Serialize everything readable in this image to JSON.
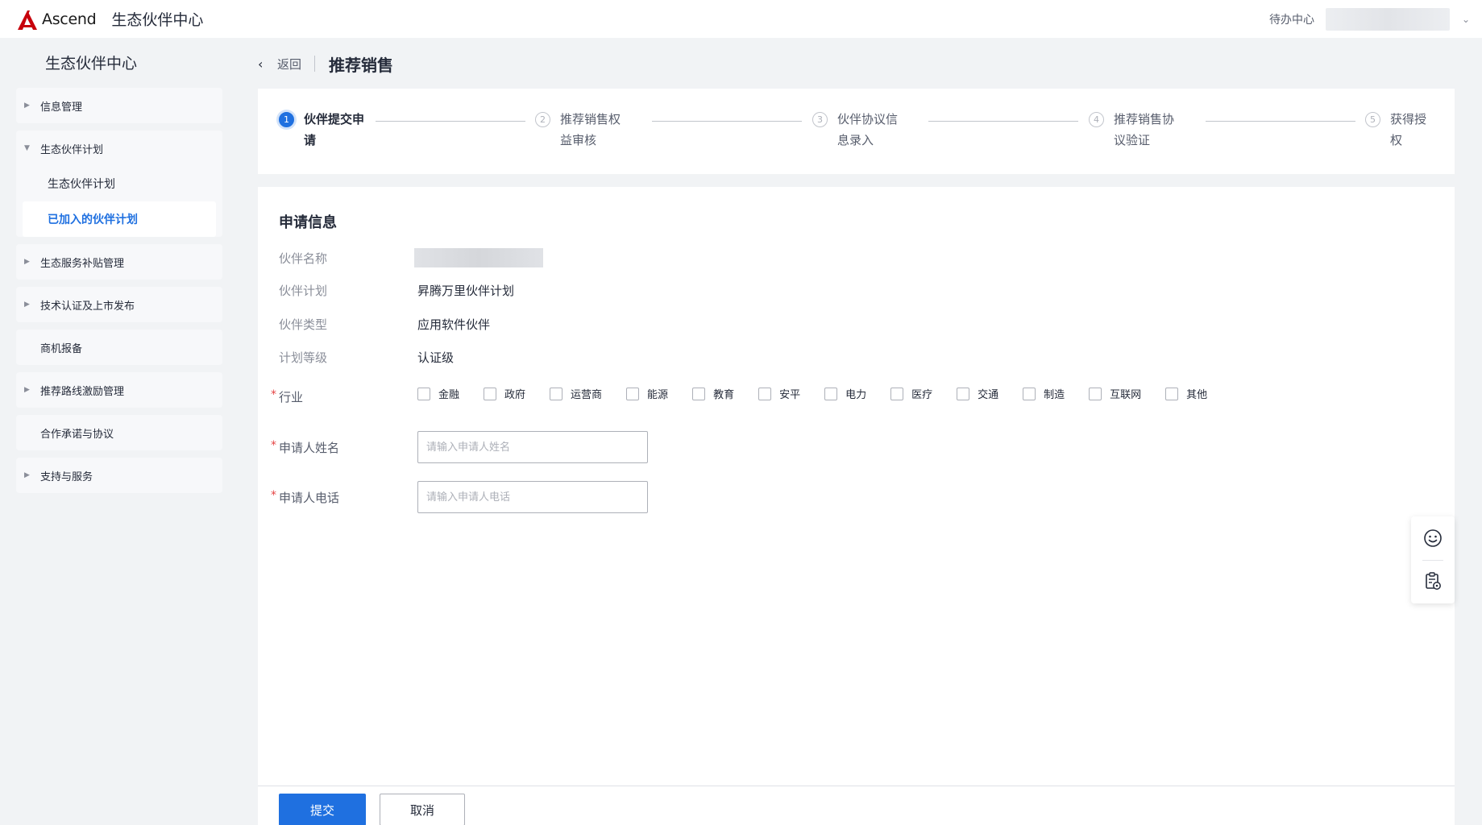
{
  "header": {
    "logo_text": "Ascend",
    "app_title": "生态伙伴中心",
    "todo_label": "待办中心",
    "user_chevron": "⌄",
    "brand_color": "#c7000b"
  },
  "sidebar": {
    "title": "生态伙伴中心",
    "items": [
      {
        "label": "信息管理",
        "arrow": "▶"
      },
      {
        "label": "生态伙伴计划",
        "arrow": "▼",
        "children": [
          {
            "label": "生态伙伴计划"
          },
          {
            "label": "已加入的伙伴计划"
          }
        ]
      },
      {
        "label": "生态服务补贴管理",
        "arrow": "▶"
      },
      {
        "label": "技术认证及上市发布",
        "arrow": "▶"
      },
      {
        "label": "商机报备"
      },
      {
        "label": "推荐路线激励管理",
        "arrow": "▶"
      },
      {
        "label": "合作承诺与协议"
      },
      {
        "label": "支持与服务",
        "arrow": "▶"
      }
    ]
  },
  "breadcrumb": {
    "back_icon": "‹",
    "back_label": "返回",
    "page_title": "推荐销售"
  },
  "steps": [
    {
      "num": "1",
      "label": "伙伴提交申请"
    },
    {
      "num": "2",
      "label": "推荐销售权益审核"
    },
    {
      "num": "3",
      "label": "伙伴协议信息录入"
    },
    {
      "num": "4",
      "label": "推荐销售协议验证"
    },
    {
      "num": "5",
      "label": "获得授权"
    }
  ],
  "form": {
    "section_title": "申请信息",
    "partner_name_label": "伙伴名称",
    "partner_plan_label": "伙伴计划",
    "partner_plan_value": "昇腾万里伙伴计划",
    "partner_type_label": "伙伴类型",
    "partner_type_value": "应用软件伙伴",
    "plan_level_label": "计划等级",
    "plan_level_value": "认证级",
    "industry_label": "行业",
    "industries": [
      "金融",
      "政府",
      "运营商",
      "能源",
      "教育",
      "安平",
      "电力",
      "医疗",
      "交通",
      "制造",
      "互联网",
      "其他"
    ],
    "applicant_name_label": "申请人姓名",
    "applicant_name_placeholder": "请输入申请人姓名",
    "applicant_phone_label": "申请人电话",
    "applicant_phone_placeholder": "请输入申请人电话",
    "required_mark": "*"
  },
  "footer": {
    "submit_label": "提交",
    "cancel_label": "取消"
  },
  "colors": {
    "primary": "#1f70e0",
    "required": "#e54545"
  },
  "icons": [
    "smile-icon",
    "clipboard-settings-icon"
  ]
}
